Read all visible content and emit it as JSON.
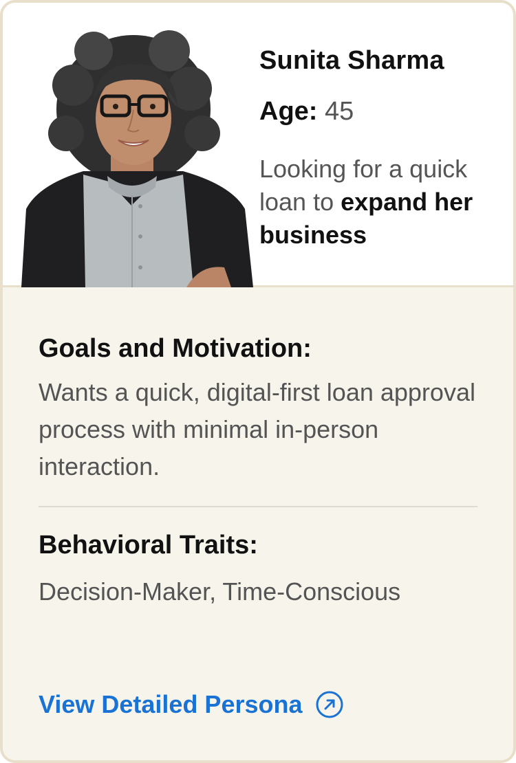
{
  "persona": {
    "name": "Sunita Sharma",
    "age_label": "Age:",
    "age_value": "45",
    "desc_plain": "Looking for a quick loan to ",
    "desc_bold": "expand her business"
  },
  "sections": {
    "goals_title": "Goals and Motivation:",
    "goals_text": "Wants a quick, digital-first loan approval process with minimal in-person interaction.",
    "traits_title": "Behavioral Traits:",
    "traits_text": "Decision-Maker, Time-Conscious"
  },
  "cta": {
    "label": "View Detailed Persona",
    "icon": "external-arrow-circle-icon"
  },
  "colors": {
    "accent": "#1a73d4",
    "border": "#e8dfca",
    "panel_bg": "#f7f4ec"
  }
}
